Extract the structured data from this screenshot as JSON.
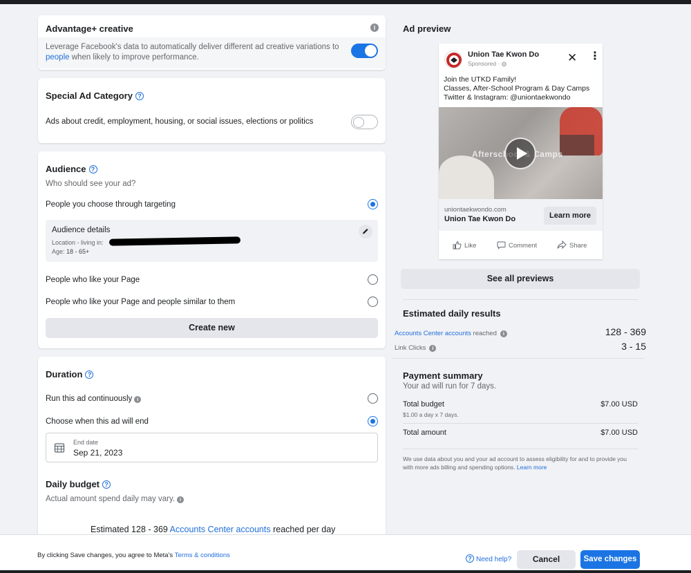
{
  "advantage": {
    "title": "Advantage+ creative",
    "desc_part1": "Leverage Facebook's data to automatically deliver different ad creative variations to",
    "desc_link": "people",
    "desc_part2": "when likely to improve performance.",
    "toggle_on": true
  },
  "special": {
    "title": "Special Ad Category",
    "desc": "Ads about credit, employment, housing, or social issues, elections or politics",
    "toggle_on": false
  },
  "audience": {
    "title": "Audience",
    "subtitle": "Who should see your ad?",
    "options": [
      {
        "label": "People you choose through targeting",
        "selected": true
      },
      {
        "label": "People who like your Page",
        "selected": false
      },
      {
        "label": "People who like your Page and people similar to them",
        "selected": false
      }
    ],
    "details": {
      "title": "Audience details",
      "location_label": "Location - living in:",
      "age_label": "Age:",
      "age_value": "18 - 65+"
    },
    "create_new": "Create new"
  },
  "duration": {
    "title": "Duration",
    "options": [
      {
        "label": "Run this ad continuously",
        "selected": false
      },
      {
        "label": "Choose when this ad will end",
        "selected": true
      }
    ],
    "end_date_label": "End date",
    "end_date_value": "Sep 21, 2023"
  },
  "daily_budget": {
    "title": "Daily budget",
    "subtitle": "Actual amount spend daily may vary.",
    "estimate_prefix": "Estimated 128 - 369",
    "estimate_link": "Accounts Center accounts",
    "estimate_suffix": "reached per day"
  },
  "preview": {
    "title": "Ad preview",
    "page_name": "Union Tae Kwon Do",
    "sponsored": "Sponsored",
    "body_lines": [
      "Join the UTKD Family!",
      "Classes, After-School Program & Day Camps",
      "Twitter & Instagram: @uniontaekwondo"
    ],
    "video_text": "Afterschool & Camps",
    "domain": "uniontaekwondo.com",
    "headline": "Union Tae Kwon Do",
    "cta": "Learn more",
    "actions": [
      "Like",
      "Comment",
      "Share"
    ],
    "see_all": "See all previews"
  },
  "estimated": {
    "title": "Estimated daily results",
    "rows": [
      {
        "label_link": "Accounts Center accounts",
        "label_rest": "reached",
        "value": "128 - 369"
      },
      {
        "label_link": "",
        "label_rest": "Link Clicks",
        "value": "3 - 15"
      }
    ]
  },
  "payment": {
    "title": "Payment summary",
    "subtitle": "Your ad will run for 7 days.",
    "total_budget_label": "Total budget",
    "total_budget_value": "$7.00 USD",
    "total_budget_sub": "$1.00 a day x 7 days.",
    "total_amount_label": "Total amount",
    "total_amount_value": "$7.00 USD",
    "disclaimer": "We use data about you and your ad account to assess eligibility for and to provide you with more ads billing and spending options.",
    "disclaimer_link": "Learn more"
  },
  "footer": {
    "terms_prefix": "By clicking Save changes, you agree to Meta's",
    "terms_link": "Terms & conditions",
    "need_help": "Need help?",
    "cancel": "Cancel",
    "save": "Save changes"
  },
  "colors": {
    "accent": "#1b74e4",
    "link": "#216fdb",
    "background": "#f0f2f5"
  }
}
